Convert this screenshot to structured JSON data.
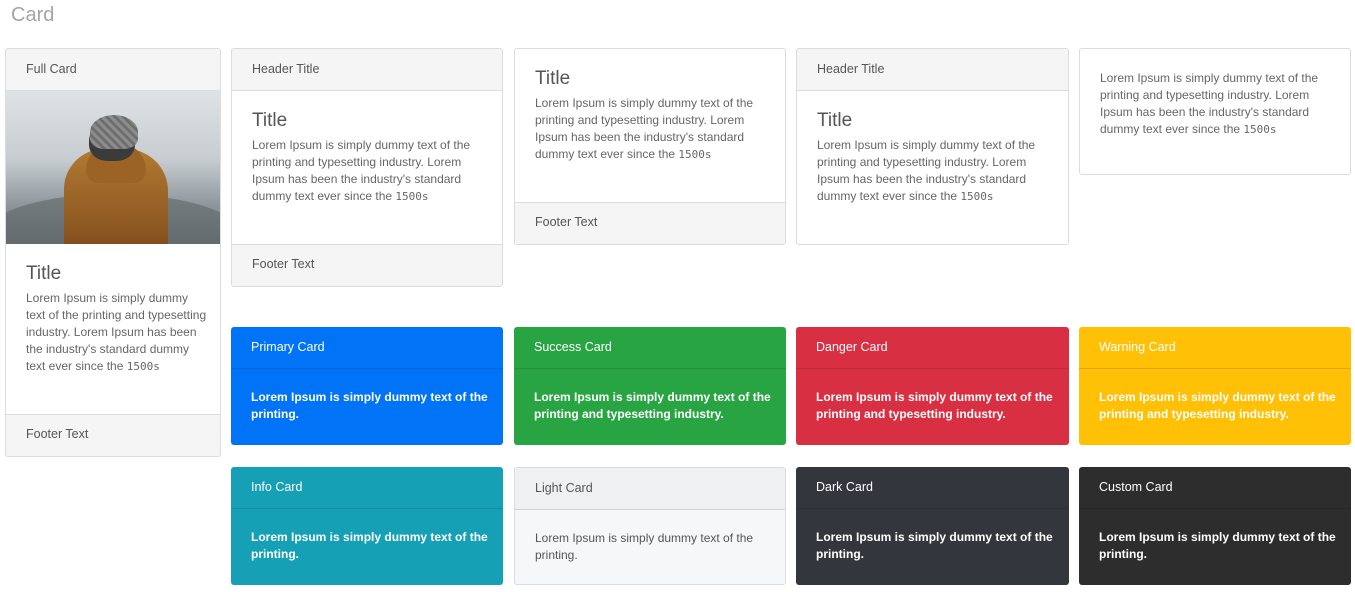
{
  "page": {
    "title": "Card"
  },
  "full_card": {
    "header": "Full Card",
    "title": "Title",
    "text": "Lorem Ipsum is simply dummy text of the printing and typesetting industry. Lorem Ipsum has been the industry's standard dummy text ever since the ",
    "text_mono": "1500s",
    "footer": "Footer Text"
  },
  "card_2": {
    "header": "Header Title",
    "title": "Title",
    "text": "Lorem Ipsum is simply dummy text of the printing and typesetting industry. Lorem Ipsum has been the industry's standard dummy text ever since the ",
    "text_mono": "1500s",
    "footer": "Footer Text"
  },
  "card_3": {
    "title": "Title",
    "text": "Lorem Ipsum is simply dummy text of the printing and typesetting industry. Lorem Ipsum has been the industry's standard dummy text ever since the ",
    "text_mono": "1500s",
    "footer": "Footer Text"
  },
  "card_4": {
    "header": "Header Title",
    "title": "Title",
    "text": "Lorem Ipsum is simply dummy text of the printing and typesetting industry. Lorem Ipsum has been the industry's standard dummy text ever since the ",
    "text_mono": "1500s"
  },
  "card_5": {
    "text": "Lorem Ipsum is simply dummy text of the printing and typesetting industry. Lorem Ipsum has been the industry's standard dummy text ever since the ",
    "text_mono": "1500s"
  },
  "color_cards": {
    "primary": {
      "header": "Primary Card",
      "text": "Lorem Ipsum is simply dummy text of the printing.",
      "bg": "#0073f7",
      "fg": "#ffffff"
    },
    "success": {
      "header": "Success Card",
      "text": "Lorem Ipsum is simply dummy text of the printing and typesetting industry.",
      "bg": "#28a443",
      "fg": "#ffffff"
    },
    "danger": {
      "header": "Danger Card",
      "text": "Lorem Ipsum is simply dummy text of the printing and typesetting industry.",
      "bg": "#d92f43",
      "fg": "#ffffff"
    },
    "warning": {
      "header": "Warning Card",
      "text": "Lorem Ipsum is simply dummy text of the printing and typesetting industry.",
      "bg": "#ffc006",
      "fg": "#ffffff"
    },
    "info": {
      "header": "Info Card",
      "text": "Lorem Ipsum is simply dummy text of the printing.",
      "bg": "#15a0b6",
      "fg": "#ffffff"
    },
    "light": {
      "header": "Light Card",
      "text": "Lorem Ipsum is simply dummy text of the printing.",
      "bg": "#f6f7f9",
      "fg": "#555555"
    },
    "dark": {
      "header": "Dark Card",
      "text": "Lorem Ipsum is simply dummy text of the printing.",
      "bg": "#33373d",
      "fg": "#ffffff"
    },
    "custom": {
      "header": "Custom Card",
      "text": "Lorem Ipsum is simply dummy text of the printing.",
      "bg": "#2d2d2d",
      "fg": "#ffffff"
    }
  }
}
